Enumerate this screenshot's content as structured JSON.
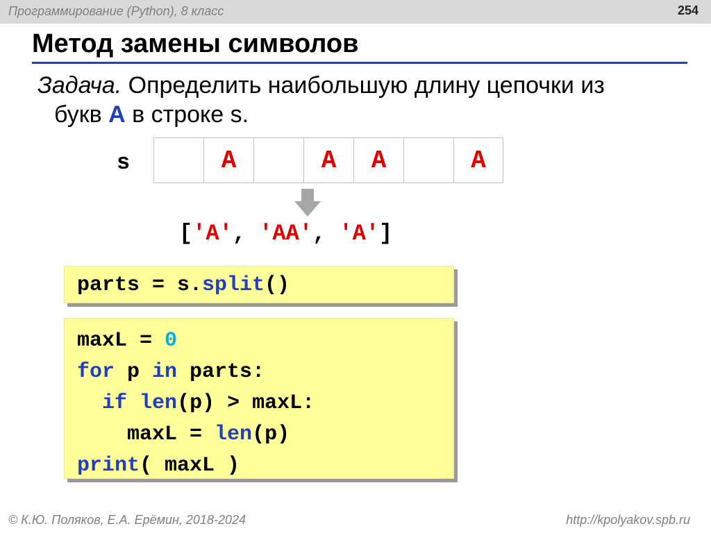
{
  "header": {
    "course": "Программирование (Python), 8 класс",
    "page_number": "254"
  },
  "title": "Метод замены символов",
  "task": {
    "lead": "Задача.",
    "text1": " Определить наибольшую длину цепочки из",
    "text2a": "букв ",
    "letter": "A",
    "text2b": " в строке s."
  },
  "diagram": {
    "var_label": "s",
    "cells": [
      "",
      "A",
      "",
      "A",
      "A",
      "",
      "A"
    ],
    "result_open": "[",
    "result_items": [
      "'A'",
      "'AA'",
      "'A'"
    ],
    "result_sep": ", ",
    "result_close": "]"
  },
  "code_split": {
    "lhs": "parts = s.",
    "method": "split",
    "rhs": "()"
  },
  "code_main": {
    "l1_a": "maxL = ",
    "l1_num": "0",
    "l2_kw1": "for",
    "l2_mid": " p ",
    "l2_kw2": "in",
    "l2_end": " parts:",
    "l3_indent": "  ",
    "l3_kw1": "if",
    "l3_sp": " ",
    "l3_kw2": "len",
    "l3_end": "(p) > maxL:",
    "l4_a": "    maxL = ",
    "l4_kw": "len",
    "l4_end": "(p)",
    "l5_kw": "print",
    "l5_end": "( maxL )"
  },
  "footer": {
    "left": "© К.Ю. Поляков, Е.А. Ерёмин, 2018-2024",
    "right": "http://kpolyakov.spb.ru"
  },
  "colors": {
    "accent_blue": "#1f3fbf",
    "string_red": "#e00000",
    "number_cyan": "#00b0f0",
    "code_bg": "#ffff99"
  }
}
